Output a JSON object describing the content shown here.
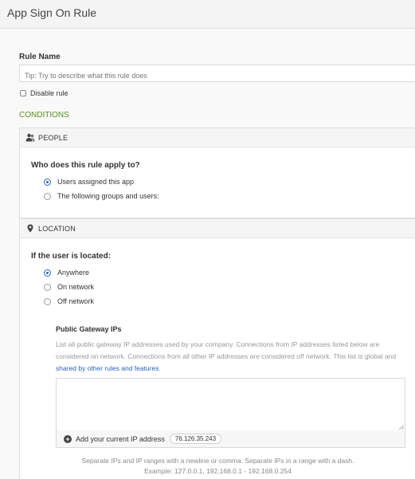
{
  "header": {
    "title": "App Sign On Rule"
  },
  "rule_name": {
    "label": "Rule Name",
    "placeholder": "Tip: Try to describe what this rule does",
    "value": ""
  },
  "disable_rule": {
    "label": "Disable rule",
    "checked": false
  },
  "conditions_label": "CONDITIONS",
  "people": {
    "header": "PEOPLE",
    "icon": "people-icon",
    "question": "Who does this rule apply to?",
    "options": [
      {
        "label": "Users assigned this app",
        "selected": true
      },
      {
        "label": "The following groups and users:",
        "selected": false
      }
    ]
  },
  "location": {
    "header": "LOCATION",
    "icon": "location-pin-icon",
    "question": "If the user is located:",
    "options": [
      {
        "label": "Anywhere",
        "selected": true
      },
      {
        "label": "On network",
        "selected": false
      },
      {
        "label": "Off network",
        "selected": false
      }
    ],
    "gateway": {
      "title": "Public Gateway IPs",
      "description_1": "List all public gateway IP addresses used by your company. Connections from IP addresses listed below are considered on network. Connections from all other IP addresses are considered off network. This list is global and ",
      "link": "shared by other rules and features",
      "description_2": ".",
      "textarea_value": "",
      "add_label": "Add your current IP address",
      "current_ip": "76.126.35.243",
      "help_line_1": "Separate IPs and IP ranges with a newline or comma. Separate IPs in a range with a dash.",
      "help_line_2": "Example: 127.0.0.1, 192.168.0.1 - 192.168.0.254"
    }
  },
  "colors": {
    "accent_green": "#5a8f1f",
    "link_blue": "#2a64b8"
  }
}
